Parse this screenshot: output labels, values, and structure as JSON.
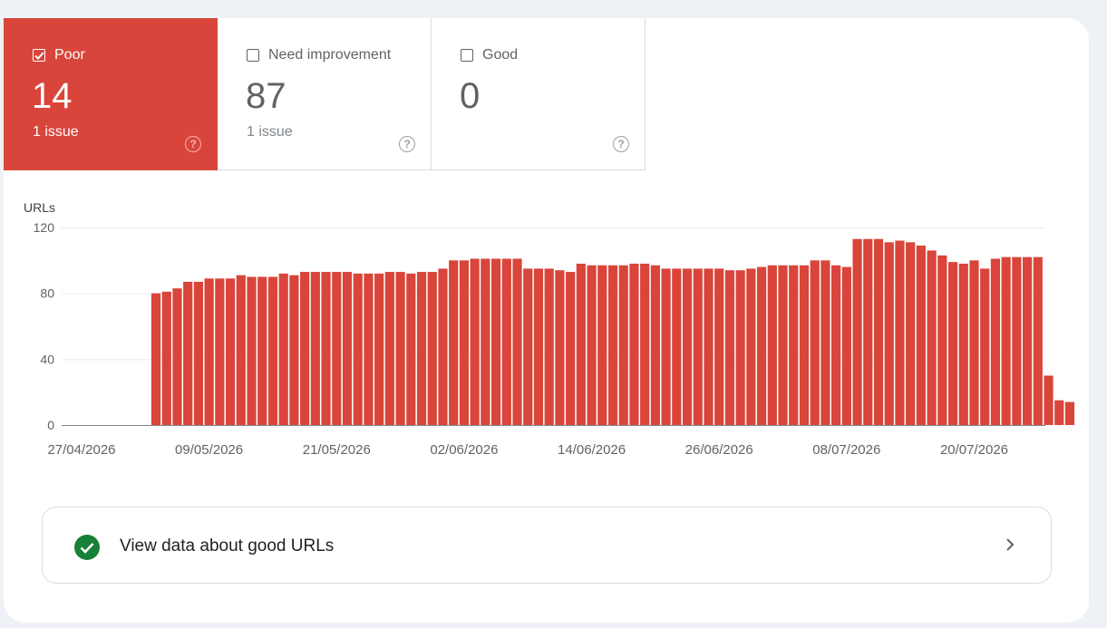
{
  "tiles": [
    {
      "label": "Poor",
      "count": "14",
      "issues": "1 issue",
      "checked": true
    },
    {
      "label": "Need improvement",
      "count": "87",
      "issues": "1 issue",
      "checked": false
    },
    {
      "label": "Good",
      "count": "0",
      "issues": "",
      "checked": false
    }
  ],
  "help_glyph": "?",
  "colors": {
    "poor": "#d9453a",
    "good": "#188038",
    "grid": "#e8eaed",
    "axis_text": "#5f6368"
  },
  "good_link": {
    "label": "View data about good URLs",
    "icon": "check-circle-icon",
    "chevron": "chevron-right-icon"
  },
  "chart_data": {
    "type": "bar",
    "ylabel": "URLs",
    "ylim": [
      0,
      120
    ],
    "yticks": [
      0,
      40,
      80,
      120
    ],
    "xticks": [
      "27/04/2026",
      "09/05/2026",
      "21/05/2026",
      "02/06/2026",
      "14/06/2026",
      "26/06/2026",
      "08/07/2026",
      "20/07/2026"
    ],
    "x_start": "27/04/2026",
    "x_end": "25/07/2026",
    "series": [
      {
        "values": [
          null,
          null,
          null,
          null,
          null,
          null,
          null,
          80,
          81,
          83,
          87,
          87,
          89,
          89,
          89,
          91,
          90,
          90,
          90,
          92,
          91,
          93,
          93,
          93,
          93,
          93,
          92,
          92,
          92,
          93,
          93,
          92,
          93,
          93,
          95,
          100,
          100,
          101,
          101,
          101,
          101,
          101,
          95,
          95,
          95,
          94,
          93,
          98,
          97,
          97,
          97,
          97,
          98,
          98,
          97,
          95,
          95,
          95,
          95,
          95,
          95,
          94,
          94,
          95,
          96,
          97,
          97,
          97,
          97,
          100,
          100,
          97,
          96,
          113,
          113,
          113,
          111,
          112,
          111,
          109,
          106,
          103,
          99,
          98,
          100,
          95,
          101,
          102,
          102,
          102,
          102,
          30,
          15,
          14
        ]
      }
    ]
  }
}
